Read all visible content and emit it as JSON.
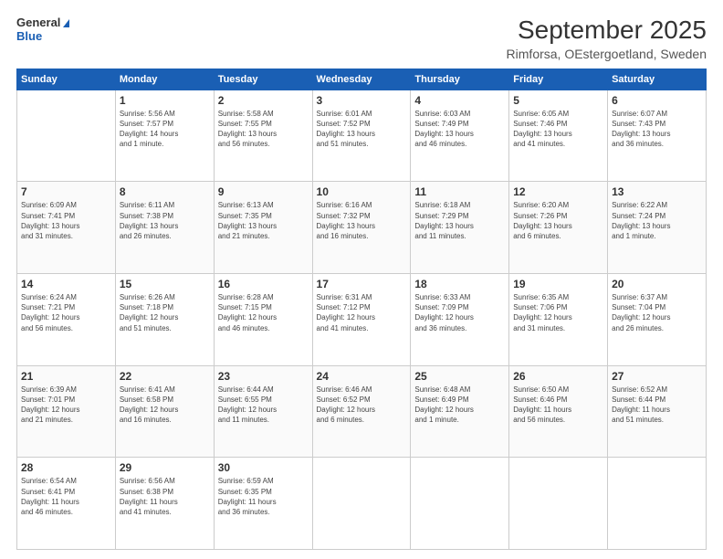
{
  "header": {
    "logo_line1": "General",
    "logo_line2": "Blue",
    "title": "September 2025",
    "subtitle": "Rimforsa, OEstergoetland, Sweden"
  },
  "days_of_week": [
    "Sunday",
    "Monday",
    "Tuesday",
    "Wednesday",
    "Thursday",
    "Friday",
    "Saturday"
  ],
  "weeks": [
    [
      {
        "day": "",
        "info": ""
      },
      {
        "day": "1",
        "info": "Sunrise: 5:56 AM\nSunset: 7:57 PM\nDaylight: 14 hours\nand 1 minute."
      },
      {
        "day": "2",
        "info": "Sunrise: 5:58 AM\nSunset: 7:55 PM\nDaylight: 13 hours\nand 56 minutes."
      },
      {
        "day": "3",
        "info": "Sunrise: 6:01 AM\nSunset: 7:52 PM\nDaylight: 13 hours\nand 51 minutes."
      },
      {
        "day": "4",
        "info": "Sunrise: 6:03 AM\nSunset: 7:49 PM\nDaylight: 13 hours\nand 46 minutes."
      },
      {
        "day": "5",
        "info": "Sunrise: 6:05 AM\nSunset: 7:46 PM\nDaylight: 13 hours\nand 41 minutes."
      },
      {
        "day": "6",
        "info": "Sunrise: 6:07 AM\nSunset: 7:43 PM\nDaylight: 13 hours\nand 36 minutes."
      }
    ],
    [
      {
        "day": "7",
        "info": "Sunrise: 6:09 AM\nSunset: 7:41 PM\nDaylight: 13 hours\nand 31 minutes."
      },
      {
        "day": "8",
        "info": "Sunrise: 6:11 AM\nSunset: 7:38 PM\nDaylight: 13 hours\nand 26 minutes."
      },
      {
        "day": "9",
        "info": "Sunrise: 6:13 AM\nSunset: 7:35 PM\nDaylight: 13 hours\nand 21 minutes."
      },
      {
        "day": "10",
        "info": "Sunrise: 6:16 AM\nSunset: 7:32 PM\nDaylight: 13 hours\nand 16 minutes."
      },
      {
        "day": "11",
        "info": "Sunrise: 6:18 AM\nSunset: 7:29 PM\nDaylight: 13 hours\nand 11 minutes."
      },
      {
        "day": "12",
        "info": "Sunrise: 6:20 AM\nSunset: 7:26 PM\nDaylight: 13 hours\nand 6 minutes."
      },
      {
        "day": "13",
        "info": "Sunrise: 6:22 AM\nSunset: 7:24 PM\nDaylight: 13 hours\nand 1 minute."
      }
    ],
    [
      {
        "day": "14",
        "info": "Sunrise: 6:24 AM\nSunset: 7:21 PM\nDaylight: 12 hours\nand 56 minutes."
      },
      {
        "day": "15",
        "info": "Sunrise: 6:26 AM\nSunset: 7:18 PM\nDaylight: 12 hours\nand 51 minutes."
      },
      {
        "day": "16",
        "info": "Sunrise: 6:28 AM\nSunset: 7:15 PM\nDaylight: 12 hours\nand 46 minutes."
      },
      {
        "day": "17",
        "info": "Sunrise: 6:31 AM\nSunset: 7:12 PM\nDaylight: 12 hours\nand 41 minutes."
      },
      {
        "day": "18",
        "info": "Sunrise: 6:33 AM\nSunset: 7:09 PM\nDaylight: 12 hours\nand 36 minutes."
      },
      {
        "day": "19",
        "info": "Sunrise: 6:35 AM\nSunset: 7:06 PM\nDaylight: 12 hours\nand 31 minutes."
      },
      {
        "day": "20",
        "info": "Sunrise: 6:37 AM\nSunset: 7:04 PM\nDaylight: 12 hours\nand 26 minutes."
      }
    ],
    [
      {
        "day": "21",
        "info": "Sunrise: 6:39 AM\nSunset: 7:01 PM\nDaylight: 12 hours\nand 21 minutes."
      },
      {
        "day": "22",
        "info": "Sunrise: 6:41 AM\nSunset: 6:58 PM\nDaylight: 12 hours\nand 16 minutes."
      },
      {
        "day": "23",
        "info": "Sunrise: 6:44 AM\nSunset: 6:55 PM\nDaylight: 12 hours\nand 11 minutes."
      },
      {
        "day": "24",
        "info": "Sunrise: 6:46 AM\nSunset: 6:52 PM\nDaylight: 12 hours\nand 6 minutes."
      },
      {
        "day": "25",
        "info": "Sunrise: 6:48 AM\nSunset: 6:49 PM\nDaylight: 12 hours\nand 1 minute."
      },
      {
        "day": "26",
        "info": "Sunrise: 6:50 AM\nSunset: 6:46 PM\nDaylight: 11 hours\nand 56 minutes."
      },
      {
        "day": "27",
        "info": "Sunrise: 6:52 AM\nSunset: 6:44 PM\nDaylight: 11 hours\nand 51 minutes."
      }
    ],
    [
      {
        "day": "28",
        "info": "Sunrise: 6:54 AM\nSunset: 6:41 PM\nDaylight: 11 hours\nand 46 minutes."
      },
      {
        "day": "29",
        "info": "Sunrise: 6:56 AM\nSunset: 6:38 PM\nDaylight: 11 hours\nand 41 minutes."
      },
      {
        "day": "30",
        "info": "Sunrise: 6:59 AM\nSunset: 6:35 PM\nDaylight: 11 hours\nand 36 minutes."
      },
      {
        "day": "",
        "info": ""
      },
      {
        "day": "",
        "info": ""
      },
      {
        "day": "",
        "info": ""
      },
      {
        "day": "",
        "info": ""
      }
    ]
  ]
}
